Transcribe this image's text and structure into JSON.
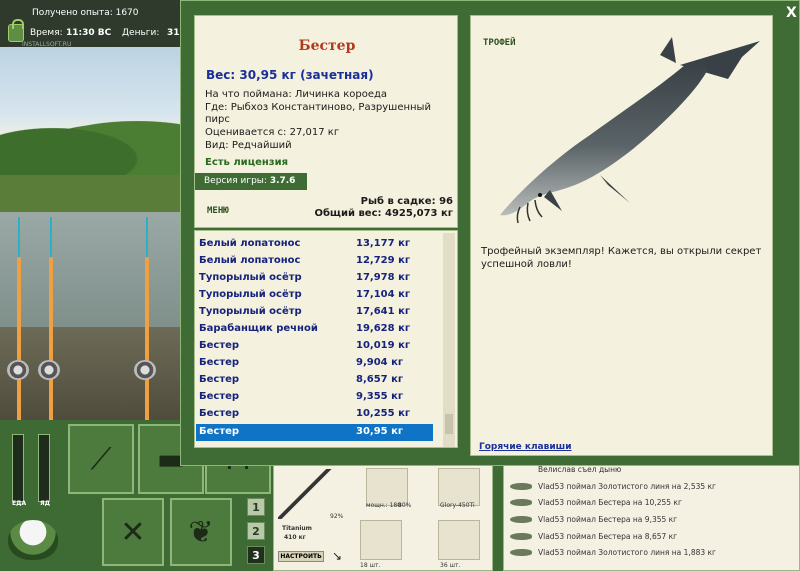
{
  "hud_top": {
    "experience": "Получено опыта: 1670",
    "time_label": "Время:",
    "time_value": "11:30 ВС",
    "money_label": "Деньги:",
    "money_value": "31",
    "watermark": "INSTALLSOFT.RU"
  },
  "dialog": {
    "close": "X",
    "fish_name": "Бестер",
    "weight_line": "Вес: 30,95 кг (зачетная)",
    "caught_on": "На что поймана: Личинка короеда",
    "where_line1": "Где: Рыбхоз Константиново, Разрушенный",
    "where_line2": "пирс",
    "valued": "Оценивается с: 27,017 кг",
    "kind": "Вид: Редчайший",
    "license": "Есть лицензия",
    "version_label": "Версия игры:",
    "version_value": "3.7.6",
    "menu": "МЕНЮ",
    "keepnet_count": "Рыб в садке: 96",
    "keepnet_weight": "Общий вес: 4925,073 кг"
  },
  "catch_list": [
    {
      "name": "Белый лопатонос",
      "weight": "13,177 кг"
    },
    {
      "name": "Белый лопатонос",
      "weight": "12,729 кг"
    },
    {
      "name": "Тупорылый осётр",
      "weight": "17,978 кг"
    },
    {
      "name": "Тупорылый осётр",
      "weight": "17,104 кг"
    },
    {
      "name": "Тупорылый осётр",
      "weight": "17,641 кг"
    },
    {
      "name": "Барабанщик речной",
      "weight": "19,628 кг"
    },
    {
      "name": "Бестер",
      "weight": "10,019 кг"
    },
    {
      "name": "Бестер",
      "weight": "9,904 кг"
    },
    {
      "name": "Бестер",
      "weight": "8,657 кг"
    },
    {
      "name": "Бестер",
      "weight": "9,355 кг"
    },
    {
      "name": "Бестер",
      "weight": "10,255 кг"
    },
    {
      "name": "Бестер",
      "weight": "30,95 кг"
    }
  ],
  "trophy": {
    "tag": "ТРОФЕЙ",
    "text": "Трофейный экземпляр! Кажется, вы открыли секрет успешной ловли!",
    "hotkeys": "Горячие клавиши"
  },
  "hud_bottom": {
    "food_label": "ЕДА",
    "poison_label": "ЯД",
    "slot_numbers": [
      "1",
      "2",
      "3"
    ],
    "active_slot": "3",
    "rod_name": "Titanium",
    "rod_weight": "410 кг",
    "rod_percent": "92%",
    "setup_button": "НАСТРОИТЬ",
    "reel_caption": "мощн.: 180",
    "reel_value": "80%",
    "line_caption": "Glory-450Ti",
    "hooks_caption": "18 шт.",
    "bait_caption": "36 шт.",
    "log": [
      "Велислав съел дыню",
      "Vlad53 поймал Золотистого линя на 2,535 кг",
      "Vlad53 поймал Бестера на 10,255 кг",
      "Vlad53 поймал Бестера на 9,355 кг",
      "Vlad53 поймал Бестера на 8,657 кг",
      "Vlad53 поймал Золотистого линя на 1,883 кг"
    ]
  }
}
